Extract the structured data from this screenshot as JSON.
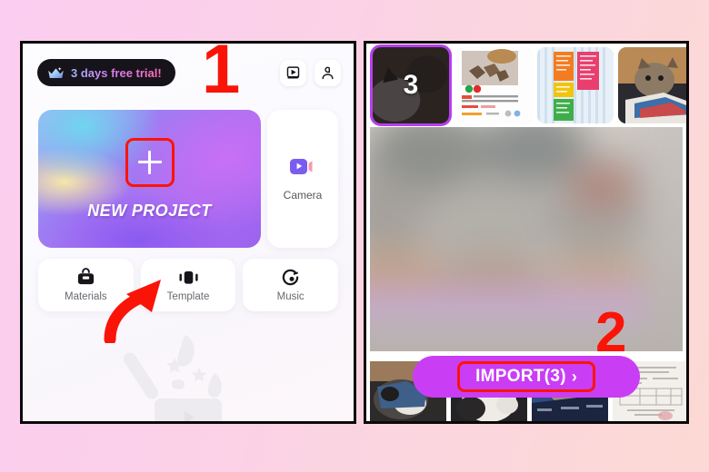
{
  "background": {
    "gradient_from": "#fbcdf0",
    "gradient_to": "#fcd9d4"
  },
  "annotations": [
    {
      "id": "step-1",
      "label": "1",
      "color": "#fa1408",
      "target": "new-project-card"
    },
    {
      "id": "step-2",
      "label": "2",
      "color": "#fa1408",
      "target": "import-button"
    }
  ],
  "left_panel": {
    "trial_badge": {
      "text": "3 days free trial!",
      "icon": "crown-icon"
    },
    "top_icons": [
      {
        "name": "tutorial-icon",
        "label": "Tutorial"
      },
      {
        "name": "profile-icon",
        "label": "Profile"
      }
    ],
    "new_project": {
      "label": "NEW PROJECT",
      "icon": "plus-icon"
    },
    "camera": {
      "label": "Camera",
      "icon": "camera-icon"
    },
    "tools": [
      {
        "label": "Materials",
        "icon": "materials-icon"
      },
      {
        "label": "Template",
        "icon": "template-icon"
      },
      {
        "label": "Music",
        "icon": "music-icon"
      }
    ]
  },
  "right_panel": {
    "selected_count": "3",
    "thumbnails": [
      {
        "name": "thumb-cat-dark",
        "selected": true,
        "badge": "3"
      },
      {
        "name": "thumb-listing",
        "selected": false,
        "badge": ""
      },
      {
        "name": "thumb-chart",
        "selected": false,
        "badge": ""
      },
      {
        "name": "thumb-kitten",
        "selected": false,
        "badge": ""
      }
    ],
    "bottom_thumbnails": [
      {
        "name": "thumb-cat-lap"
      },
      {
        "name": "thumb-cat-white"
      },
      {
        "name": "thumb-cat-blanket"
      },
      {
        "name": "thumb-document"
      }
    ],
    "import_button": {
      "label": "IMPORT(3)",
      "chevron": "›",
      "color": "#c93ef5"
    }
  }
}
